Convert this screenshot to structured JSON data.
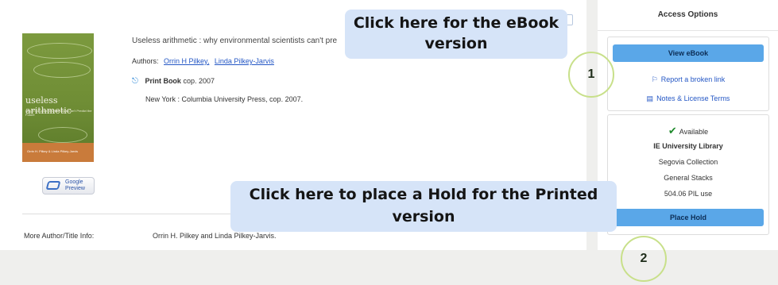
{
  "record": {
    "title": "Useless arithmetic : why environmental scientists can't pre",
    "authors_label": "Authors:",
    "authors": [
      "Orrin H Pilkey,",
      "Linda Pilkey-Jarvis"
    ],
    "format_label": "Print Book",
    "format_date": "cop. 2007",
    "publication": "New York : Columbia University Press, cop. 2007.",
    "more_info_label": "More Author/Title Info:",
    "more_info_value": "Orrin H. Pilkey and Linda Pilkey-Jarvis."
  },
  "cover": {
    "title": "useless arithmetic",
    "subtitle": "Why Environmental Scientists Can't Predict the Future",
    "author_band": "Orrin H. Pilkey & Linda Pilkey-Jarvis"
  },
  "google_preview": {
    "line1": "Google",
    "line2": "Preview"
  },
  "sidebar": {
    "heading": "Access Options",
    "view_ebook": "View eBook",
    "report_link": "Report a broken link",
    "notes_link": "Notes & License Terms",
    "availability": "Available",
    "library": "IE University Library",
    "collection": "Segovia Collection",
    "location": "General Stacks",
    "call_number": "504.06 PIL use",
    "place_hold": "Place Hold"
  },
  "annotations": {
    "callout1": "Click here for the eBook version",
    "callout2": "Click here to place a Hold for the Printed version",
    "marker1": "1",
    "marker2": "2"
  },
  "colors": {
    "button": "#5aa7e8",
    "callout_bg": "#d6e4f8",
    "marker_ring": "#c8e08a",
    "link": "#2457c5",
    "available_check": "#1f8a2c"
  }
}
